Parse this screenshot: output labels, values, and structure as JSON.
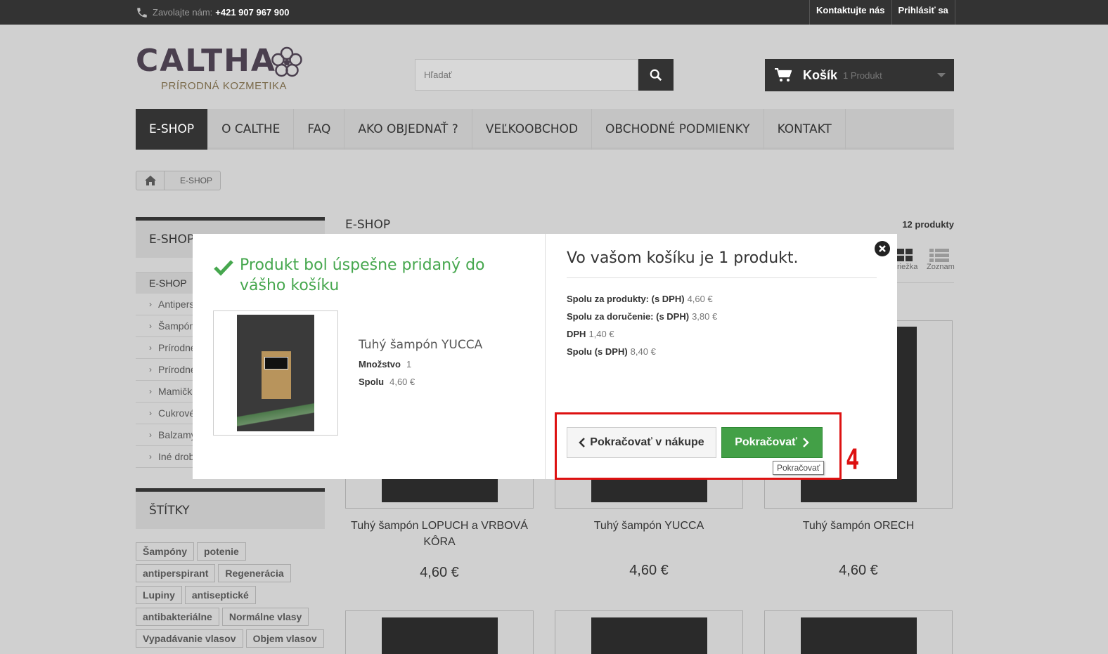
{
  "topbar": {
    "call_label": "Zavolajte nám:",
    "phone": "+421 907 967 900",
    "links": [
      "Kontaktujte nás",
      "Prihlásiť sa"
    ]
  },
  "logo": {
    "brand": "CALTHA",
    "tagline": "PRÍRODNÁ KOZMETIKA"
  },
  "search": {
    "placeholder": "Hľadať"
  },
  "cart": {
    "label": "Košík",
    "count": "1 Produkt"
  },
  "nav": {
    "items": [
      "E-SHOP",
      "O CALTHE",
      "FAQ",
      "AKO OBJEDNAŤ ?",
      "VEĽKOOBCHOD",
      "OBCHODNÉ PODMIENKY",
      "KONTAKT"
    ]
  },
  "breadcrumb": {
    "current": "E-SHOP"
  },
  "sidebar": {
    "title": "E-SHOP",
    "first": "E-SHOP",
    "items": [
      "Antipers",
      "Šampón",
      "Prírodne",
      "Prírodne",
      "Mamičk",
      "Cukrové",
      "Balzamy",
      "Iné drob"
    ],
    "tags_title": "ŠTÍTKY",
    "tags": [
      "Šampóny",
      "potenie",
      "antiperspirant",
      "Regenerácia",
      "Lupiny",
      "antiseptické",
      "antibakteriálne",
      "Normálne vlasy",
      "Vypadávanie vlasov",
      "Objem vlasov"
    ]
  },
  "main": {
    "title": "E-SHOP",
    "count": "12 produkty",
    "views": [
      "riežka",
      "Zoznam"
    ],
    "products": [
      {
        "name": "Tuhý šampón LOPUCH a VRBOVÁ KÔRA",
        "price": "4,60 €"
      },
      {
        "name": "Tuhý šampón YUCCA",
        "price": "4,60 €"
      },
      {
        "name": "Tuhý šampón ORECH",
        "price": "4,60 €"
      }
    ]
  },
  "modal": {
    "success": "Produkt bol úspešne pridaný do vášho košíku",
    "product_name": "Tuhý šampón YUCCA",
    "qty_label": "Množstvo",
    "qty": "1",
    "total_label": "Spolu",
    "total": "4,60 €",
    "cart_title": "Vo vašom košíku je 1 produkt.",
    "summary": [
      {
        "label": "Spolu za produkty: (s DPH)",
        "value": "4,60 €"
      },
      {
        "label": "Spolu za doručenie: (s DPH)",
        "value": "3,80 €"
      },
      {
        "label": "DPH",
        "value": "1,40 €"
      },
      {
        "label": "Spolu (s DPH)",
        "value": "8,40 €"
      }
    ],
    "continue_shopping": "Pokračovať v nákupe",
    "continue": "Pokračovať",
    "tooltip": "Pokračovať",
    "step": "4"
  },
  "colors": {
    "accent_green": "#43a047",
    "success_green": "#46a74e",
    "highlight_red": "#dd1111",
    "dark": "#333333"
  }
}
